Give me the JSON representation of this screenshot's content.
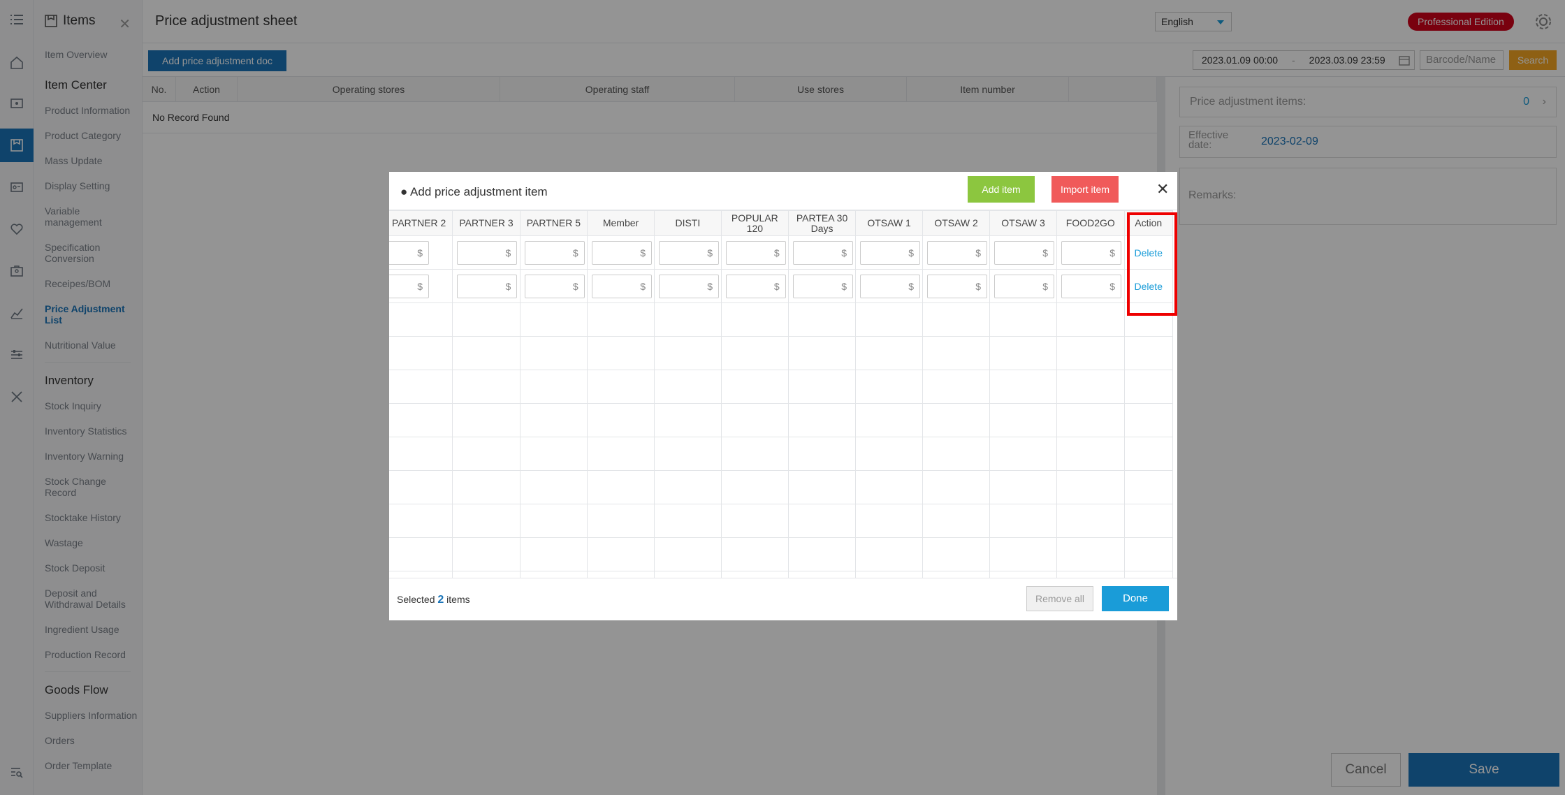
{
  "sidebar": {
    "title": "Items",
    "items": [
      {
        "type": "item",
        "label": "Item Overview"
      },
      {
        "type": "group",
        "label": "Item Center"
      },
      {
        "type": "item",
        "label": "Product Information"
      },
      {
        "type": "item",
        "label": "Product Category"
      },
      {
        "type": "item",
        "label": "Mass Update"
      },
      {
        "type": "item",
        "label": "Display Setting"
      },
      {
        "type": "item",
        "label": "Variable management"
      },
      {
        "type": "item",
        "label": "Specification Conversion"
      },
      {
        "type": "item",
        "label": "Receipes/BOM"
      },
      {
        "type": "item",
        "label": "Price Adjustment List",
        "active": true
      },
      {
        "type": "item",
        "label": "Nutritional Value"
      },
      {
        "type": "sep"
      },
      {
        "type": "group",
        "label": "Inventory"
      },
      {
        "type": "item",
        "label": "Stock Inquiry"
      },
      {
        "type": "item",
        "label": "Inventory Statistics"
      },
      {
        "type": "item",
        "label": "Inventory Warning"
      },
      {
        "type": "item",
        "label": "Stock Change Record"
      },
      {
        "type": "item",
        "label": "Stocktake History"
      },
      {
        "type": "item",
        "label": "Wastage"
      },
      {
        "type": "item",
        "label": "Stock Deposit"
      },
      {
        "type": "item",
        "label": "Deposit and Withdrawal Details"
      },
      {
        "type": "item",
        "label": "Ingredient Usage"
      },
      {
        "type": "item",
        "label": "Production Record"
      },
      {
        "type": "sep"
      },
      {
        "type": "group",
        "label": "Goods Flow"
      },
      {
        "type": "item",
        "label": "Suppliers Information"
      },
      {
        "type": "item",
        "label": "Orders"
      },
      {
        "type": "item",
        "label": "Order Template"
      }
    ]
  },
  "header": {
    "page_title": "Price adjustment sheet",
    "language": "English",
    "edition": "Professional Edition"
  },
  "toolbar": {
    "add_doc_label": "Add price adjustment doc",
    "date_start": "2023.01.09 00:00",
    "date_sep": "-",
    "date_end": "2023.03.09 23:59",
    "barcode_placeholder": "Barcode/Name",
    "search_label": "Search"
  },
  "list": {
    "columns": [
      "No.",
      "Action",
      "Operating stores",
      "Operating staff",
      "Use stores",
      "Item number"
    ],
    "empty_text": "No Record Found"
  },
  "right_panel": {
    "items_label": "Price adjustment items:",
    "items_count": "0",
    "effective_label": "Effective date:",
    "effective_value": "2023-02-09",
    "remarks_label": "Remarks:",
    "cancel_label": "Cancel",
    "save_label": "Save"
  },
  "modal": {
    "title": "● Add price adjustment item",
    "add_item_label": "Add item",
    "import_item_label": "Import item",
    "close_symbol": "✕",
    "columns": [
      "PARTNER 2",
      "PARTNER 3",
      "PARTNER 5",
      "Member",
      "DISTI",
      "POPULAR 120",
      "PARTEA 30 Days",
      "OTSAW 1",
      "OTSAW 2",
      "OTSAW 3",
      "FOOD2GO"
    ],
    "action_header": "Action",
    "currency_symbol": "$",
    "delete_label": "Delete",
    "filled_rows": 2,
    "selected_prefix": "Selected",
    "selected_count": "2",
    "selected_suffix": "items",
    "remove_all_label": "Remove all",
    "done_label": "Done"
  },
  "colors": {
    "primary": "#1a74b8",
    "link": "#1a9cd8",
    "add_item": "#8cc63f",
    "import_item": "#f05a5a",
    "edition_badge": "#d0021b",
    "search": "#f5a623",
    "highlight": "#ee0000"
  }
}
